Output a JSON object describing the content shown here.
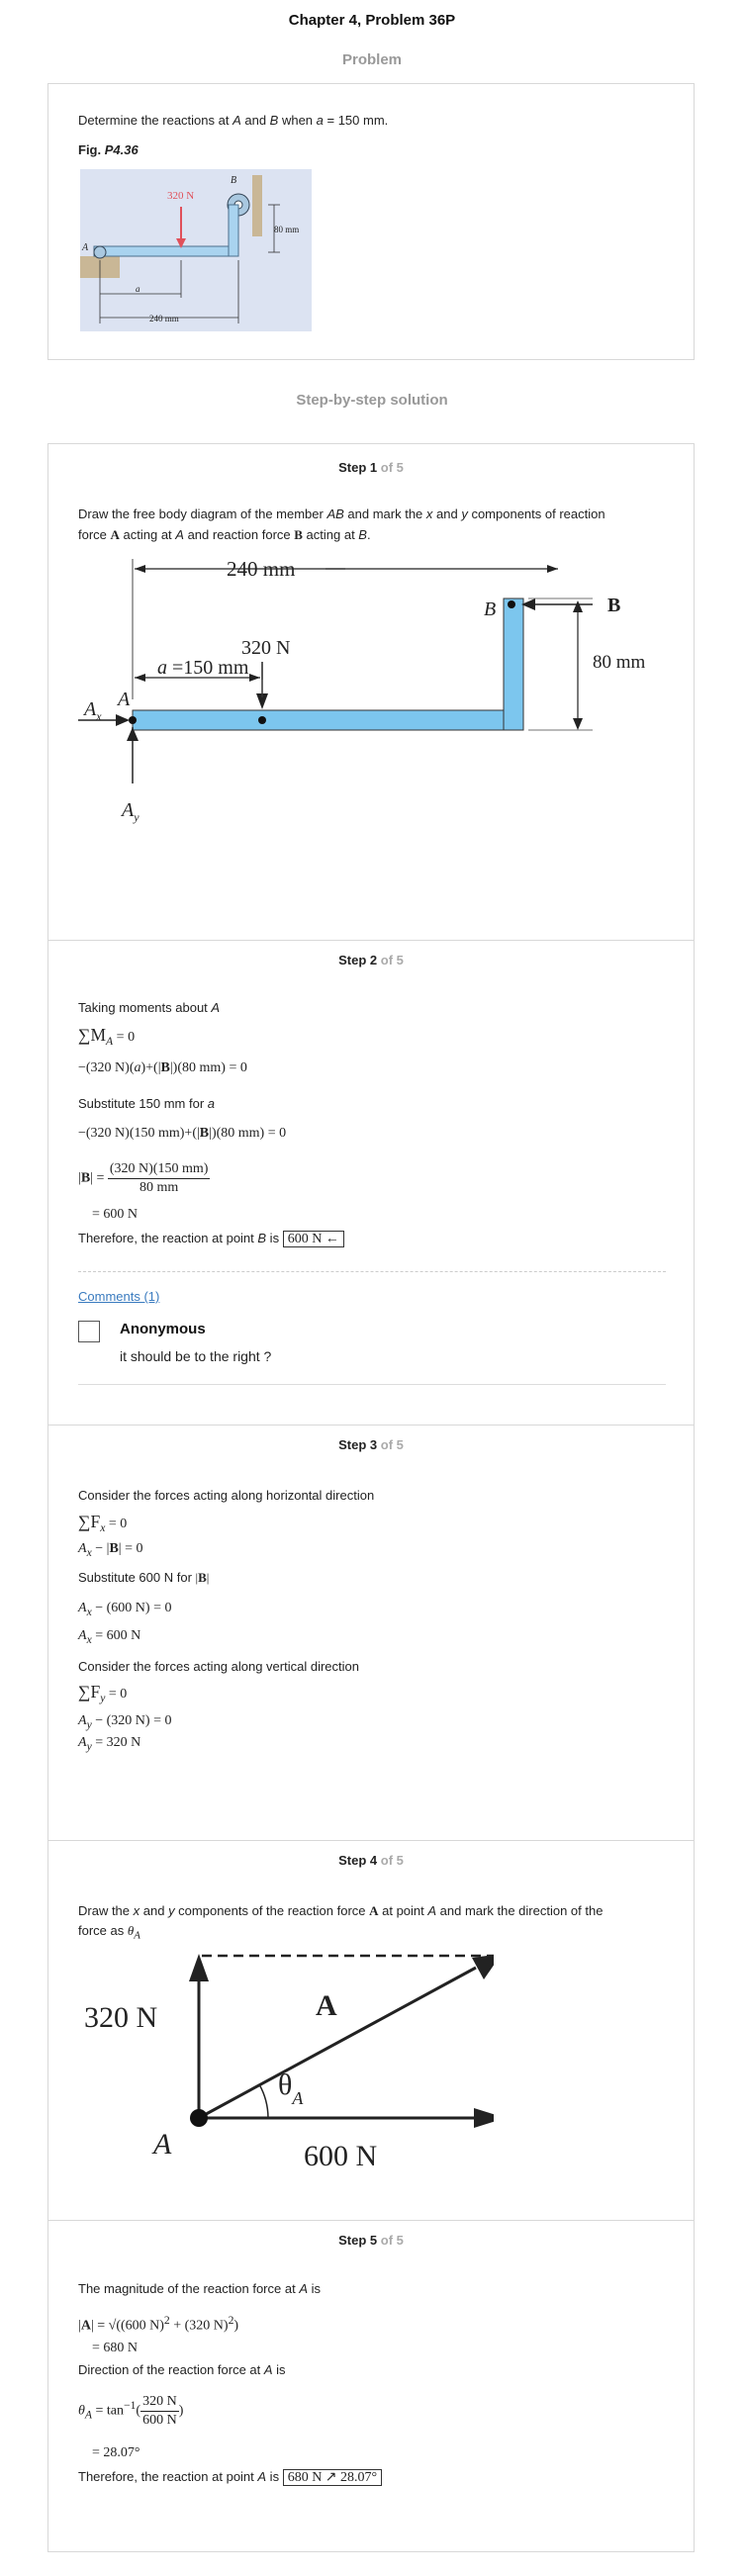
{
  "page_title": "Chapter 4, Problem 36P",
  "problem": {
    "section_label": "Problem",
    "statement_prefix": "Determine the reactions at ",
    "point_a": "A",
    "and": " and ",
    "point_b": "B",
    "when": " when ",
    "a_var": "a",
    "a_eq": " = 150 mm.",
    "fig_prefix": "Fig. ",
    "fig_id": "P4.36",
    "fig_labels": {
      "force": "320 N",
      "B": "B",
      "A": "A",
      "dim80": "80 mm",
      "dim_a": "a",
      "dim240": "240 mm"
    }
  },
  "solution_label": "Step-by-step solution",
  "steps": [
    {
      "n": "1",
      "total": "of 5",
      "text1": "Draw the free body diagram of the member ",
      "AB": "AB",
      "text2": " and mark the ",
      "x": "x",
      "text3": " and ",
      "y": "y",
      "text4": " components of reaction",
      "text5": "force ",
      "Abold": "A",
      "text6": " acting at ",
      "A": "A",
      "text7": " and reaction force ",
      "Bbold": "B",
      "text8": " acting at ",
      "B": "B",
      "text9": ".",
      "fbd": {
        "dim240": "240 mm",
        "B": "B",
        "Bforce": "B",
        "dim80": "80 mm",
        "force": "320 N",
        "a_var": "a",
        "a_eq": " =150 mm",
        "A": "A",
        "Ax": "A",
        "Ax_sub": "x",
        "Ay": "A",
        "Ay_sub": "y"
      }
    },
    {
      "n": "2",
      "total": "of 5",
      "t1": "Taking moments about ",
      "t1a": "A",
      "eq1": "∑M",
      "eq1_sub": "A",
      "eq1_rest": " = 0",
      "eq2a": "−(320 N)(",
      "eq2_a": "a",
      "eq2b": ")+(|",
      "eq2_B": "B",
      "eq2c": "|)(80 mm) = 0",
      "t2": "Substitute 150 mm for ",
      "t2a": "a",
      "eq3a": "−(320 N)(150 mm)+(|",
      "eq3_B": "B",
      "eq3b": "|)(80 mm) = 0",
      "eq4_lhs_a": "|",
      "eq4_lhs_B": "B",
      "eq4_lhs_b": "| =",
      "eq4_num": "(320 N)(150 mm)",
      "eq4_den": "80 mm",
      "eq5": "= 600 N",
      "t3": "Therefore, the reaction at point ",
      "t3b": "B",
      "t3c": " is ",
      "ans": "600 N ←",
      "comments_link": "Comments (1)",
      "comment_author": "Anonymous",
      "comment_text": "it should be to the right ?"
    },
    {
      "n": "3",
      "total": "of 5",
      "t1": "Consider the forces acting along horizontal direction",
      "eq1": "∑F",
      "eq1_sub": "x",
      "eq1_rest": " = 0",
      "eq2": "A",
      "eq2_sub": "x",
      "eq2_mid": " − |",
      "eq2_B": "B",
      "eq2_rest": "| = 0",
      "t2": "Substitute 600 N for ",
      "t2_a": "|",
      "t2_B": "B",
      "t2_b": "|",
      "eq3": "A",
      "eq3_sub": "x",
      "eq3_rest": " − (600 N) = 0",
      "eq4": "A",
      "eq4_sub": "x",
      "eq4_rest": " = 600 N",
      "t3": "Consider the forces acting along vertical direction",
      "eq5": "∑F",
      "eq5_sub": "y",
      "eq5_rest": " = 0",
      "eq6": "A",
      "eq6_sub": "y",
      "eq6_rest": " − (320 N) = 0",
      "eq7": "A",
      "eq7_sub": "y",
      "eq7_rest": " = 320 N"
    },
    {
      "n": "4",
      "total": "of 5",
      "t1": "Draw the ",
      "x": "x",
      "t2": " and ",
      "y": "y",
      "t3": " components of the reaction force ",
      "Abold": "A",
      "t4": " at point ",
      "A": "A",
      "t5": " and mark the direction of the",
      "t6": "force as ",
      "theta": "θ",
      "theta_sub": "A",
      "diag": {
        "f320": "320 N",
        "f600": "600 N",
        "A": "A",
        "Abold": "A",
        "theta": "θ",
        "theta_sub": "A"
      }
    },
    {
      "n": "5",
      "total": "of 5",
      "t1": "The magnitude of the reaction force at ",
      "t1a": "A",
      "t1b": " is",
      "eq1_a": "|",
      "eq1_A": "A",
      "eq1_b": "| = √((600 N)",
      "eq1_sq1": "2",
      "eq1_c": " + (320 N)",
      "eq1_sq2": "2",
      "eq1_d": ")",
      "eq2": "= 680 N",
      "t2": "Direction of the reaction force at ",
      "t2a": "A",
      "t2b": " is",
      "eq3_theta": "θ",
      "eq3_sub": "A",
      "eq3_mid": " = tan",
      "eq3_sup": "−1",
      "eq3_num": "320 N",
      "eq3_den": "600 N",
      "eq4": "= 28.07°",
      "t3": "Therefore, the reaction at point ",
      "t3a": "A",
      "t3b": " is ",
      "ans": "680 N ↗ 28.07°"
    }
  ]
}
